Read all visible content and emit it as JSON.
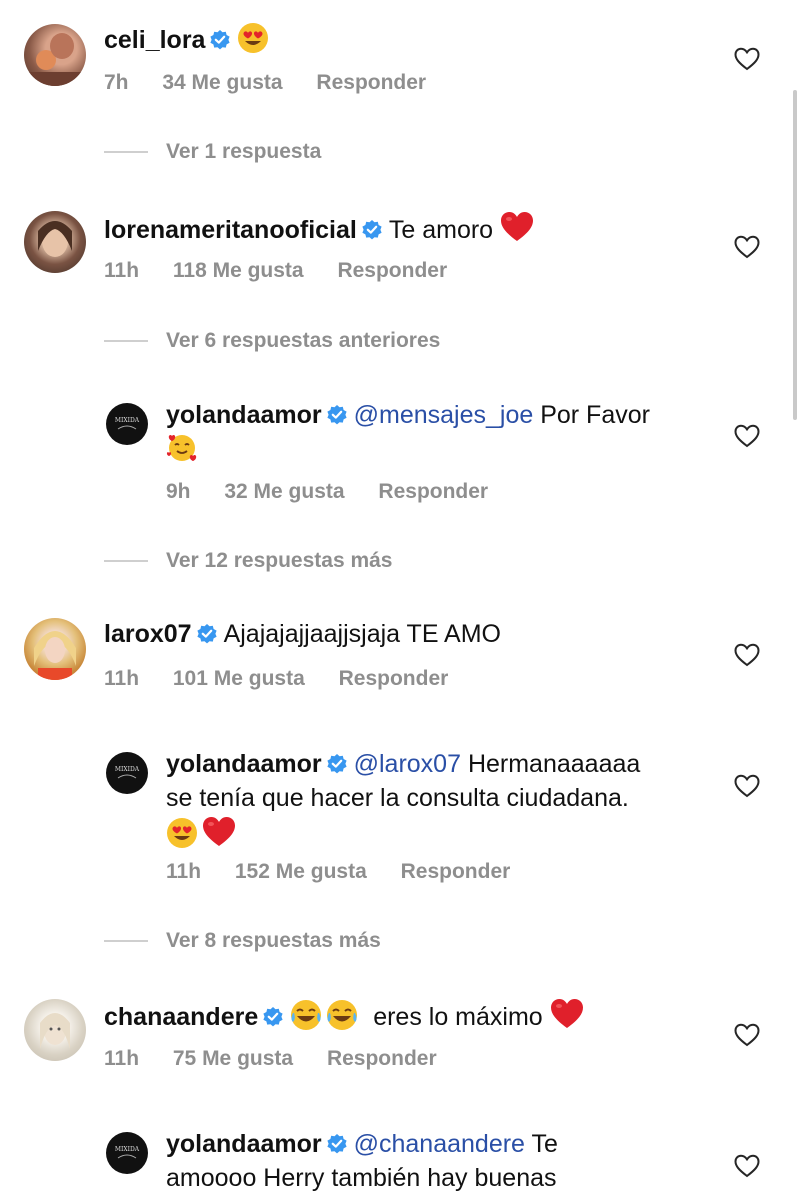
{
  "comments": [
    {
      "username": "celi_lora",
      "text": "",
      "emojis": [
        "heart-eyes"
      ],
      "time": "7h",
      "likes": "34 Me gusta",
      "reply": "Responder"
    },
    {
      "username": "lorenameritanooficial",
      "text": "Te amoro",
      "emojis": [
        "red-heart"
      ],
      "time": "11h",
      "likes": "118 Me gusta",
      "reply": "Responder"
    },
    {
      "username": "yolandaamor",
      "mention": "@mensajes_joe",
      "text": "Por Favor",
      "emojis": [
        "smiling-hearts"
      ],
      "time": "9h",
      "likes": "32 Me gusta",
      "reply": "Responder"
    },
    {
      "username": "larox07",
      "text": "Ajajajajjaajjsjaja TE AMO",
      "time": "11h",
      "likes": "101 Me gusta",
      "reply": "Responder"
    },
    {
      "username": "yolandaamor",
      "mention": "@larox07",
      "text_line1": "Hermanaaaaaa",
      "text_line2": "se tenía que hacer la consulta ciudadana.",
      "emojis": [
        "heart-eyes",
        "red-heart"
      ],
      "time": "11h",
      "likes": "152 Me gusta",
      "reply": "Responder"
    },
    {
      "username": "chanaandere",
      "text": "eres lo máximo",
      "emojis": [
        "tears-of-joy",
        "tears-of-joy",
        "red-heart"
      ],
      "time": "11h",
      "likes": "75 Me gusta",
      "reply": "Responder"
    },
    {
      "username": "yolandaamor",
      "mention": "@chanaandere",
      "text_line1": "Te",
      "text_line2": "amoooo Herry también hay buenas"
    }
  ],
  "view_more": [
    "Ver 1 respuesta",
    "Ver 6 respuestas anteriores",
    "Ver 12 respuestas más",
    "Ver 8 respuestas más"
  ],
  "avatar_logo_text": "MIXIDA"
}
